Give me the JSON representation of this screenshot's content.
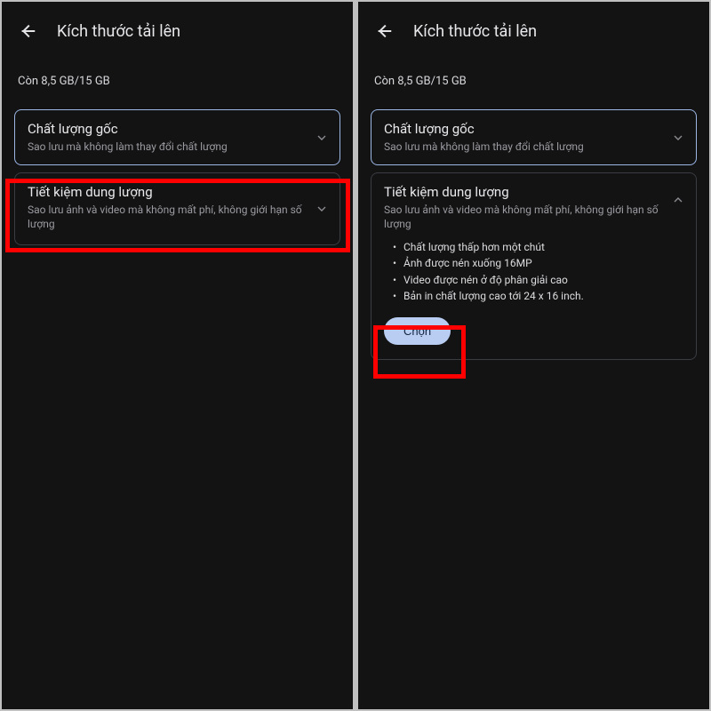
{
  "left": {
    "header_title": "Kích thước tải lên",
    "storage": "Còn 8,5 GB/15 GB",
    "card1_title": "Chất lượng gốc",
    "card1_desc": "Sao lưu mà không làm thay đổi chất lượng",
    "card2_title": "Tiết kiệm dung lượng",
    "card2_desc": "Sao lưu ảnh và video mà không mất phí, không giới hạn số lượng"
  },
  "right": {
    "header_title": "Kích thước tải lên",
    "storage": "Còn 8,5 GB/15 GB",
    "card1_title": "Chất lượng gốc",
    "card1_desc": "Sao lưu mà không làm thay đổi chất lượng",
    "card2_title": "Tiết kiệm dung lượng",
    "card2_desc": "Sao lưu ảnh và video mà không mất phí, không giới hạn số lượng",
    "bullets": {
      "b1": "Chất lượng thấp hơn một chút",
      "b2": "Ảnh được nén xuống 16MP",
      "b3": "Video được nén ở độ phân giải cao",
      "b4": "Bản in chất lượng cao tới 24 x 16 inch."
    },
    "select_label": "Chọn"
  }
}
